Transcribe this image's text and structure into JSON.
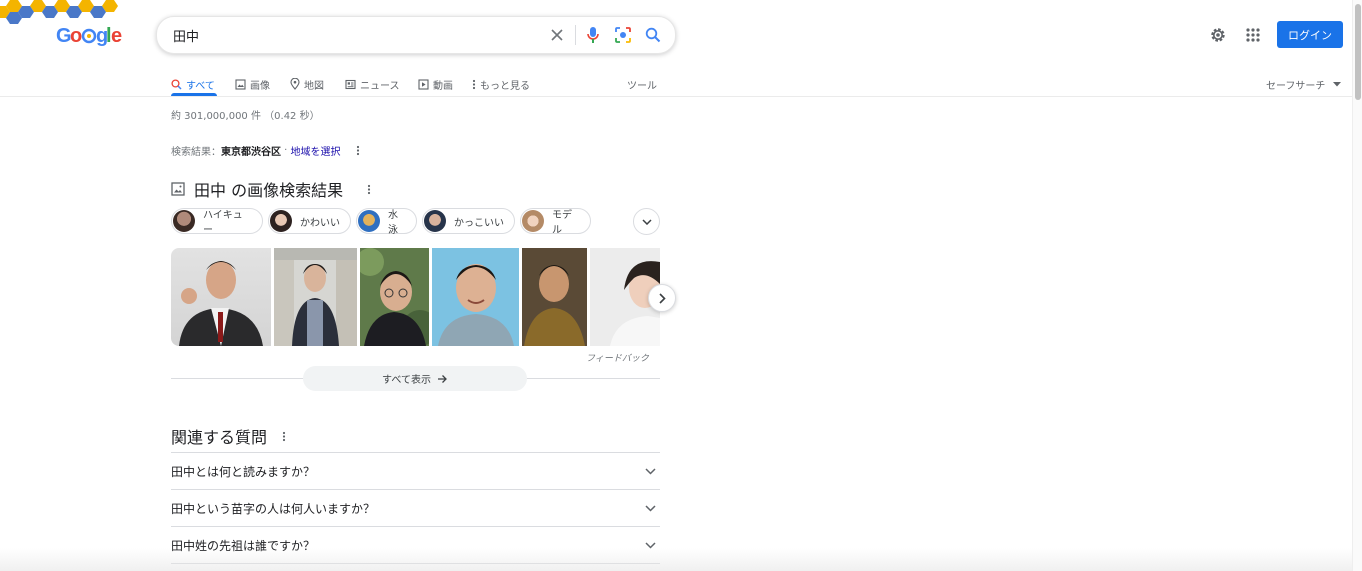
{
  "search": {
    "query": "田中"
  },
  "header": {
    "login_label": "ログイン"
  },
  "tabs": [
    {
      "label": "すべて",
      "icon": "search-icon"
    },
    {
      "label": "画像",
      "icon": "image-icon"
    },
    {
      "label": "地図",
      "icon": "map-pin-icon"
    },
    {
      "label": "ニュース",
      "icon": "news-icon"
    },
    {
      "label": "動画",
      "icon": "video-icon"
    },
    {
      "label": "もっと見る",
      "icon": "more-vert-icon"
    }
  ],
  "tools_label": "ツール",
  "safesearch_label": "セーフサーチ",
  "result_stats": "約 301,000,000 件 （0.42 秒）",
  "location": {
    "prefix": "検索結果：",
    "place": "東京都渋谷区",
    "separator": " · ",
    "link": "地域を選択"
  },
  "images_section": {
    "title": "田中 の画像検索結果",
    "chips": [
      "ハイキュー",
      "かわいい",
      "水泳",
      "かっこいい",
      "モデル"
    ],
    "feedback": "フィードバック",
    "show_all": "すべて表示"
  },
  "paa": {
    "title": "関連する質問",
    "questions": [
      "田中とは何と読みますか？",
      "田中という苗字の人は何人いますか？",
      "田中姓の先祖は誰ですか？"
    ]
  },
  "colors": {
    "accent": "#1a73e8",
    "text": "#202124",
    "muted": "#70757a",
    "link": "#1a0dab"
  }
}
